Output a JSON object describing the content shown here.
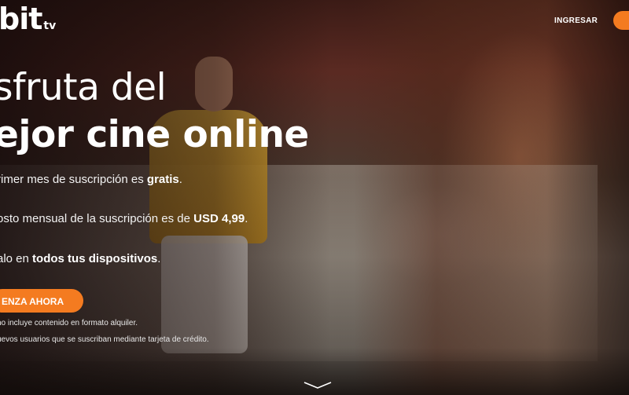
{
  "header": {
    "logo_main": "bit",
    "logo_sub": "tv",
    "login_label": "INGRESAR"
  },
  "hero": {
    "headline_line1": "sfruta del",
    "headline_line2": "ejor cine online",
    "features": [
      {
        "text": "rimer mes de suscripción es ",
        "bold": "gratis",
        "suffix": "."
      },
      {
        "text": "osto mensual de la suscripción es de ",
        "bold": "USD 4,99",
        "suffix": "."
      },
      {
        "text": "alo en ",
        "bold": "todos tus dispositivos",
        "suffix": "."
      }
    ],
    "cta_label": "ENZA AHORA",
    "notes": [
      "no incluye contenido en formato alquiler.",
      "uevos usuarios que se suscriban mediante tarjeta de crédito."
    ]
  },
  "icons": {
    "scroll": "chevron-down-icon"
  },
  "colors": {
    "accent": "#f47b20"
  }
}
